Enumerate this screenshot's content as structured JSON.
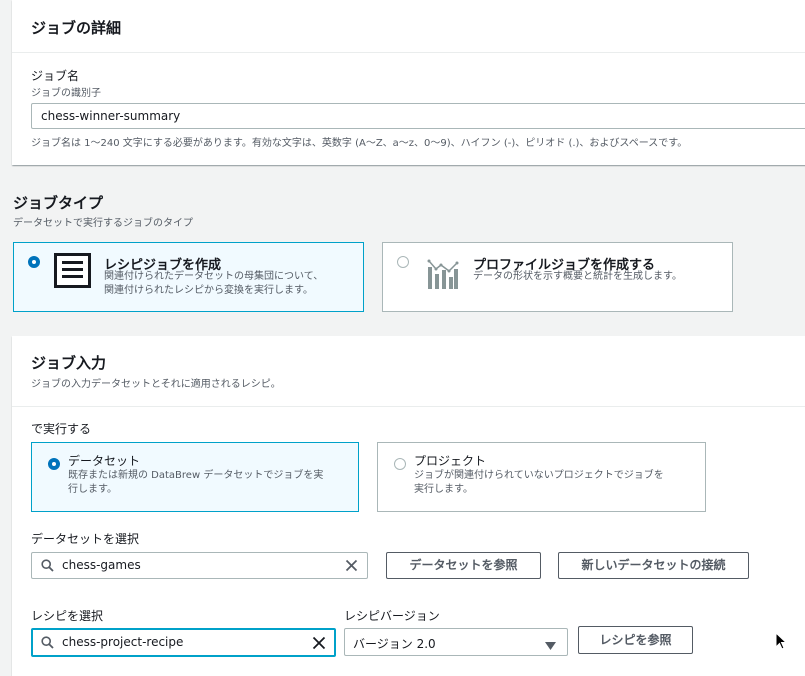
{
  "job_details": {
    "title": "ジョブの詳細",
    "name_label": "ジョブ名",
    "name_desc": "ジョブの識別子",
    "name_value": "chess-winner-summary",
    "name_hint": "ジョブ名は 1〜240 文字にする必要があります。有効な文字は、英数字 (A〜Z、a〜z、0〜9)、ハイフン (-)、ピリオド (.)、およびスペースです。"
  },
  "job_type": {
    "title": "ジョブタイプ",
    "desc": "データセットで実行するジョブのタイプ",
    "options": [
      {
        "title": "レシピジョブを作成",
        "desc_line1": "関連付けられたデータセットの母集団について、",
        "desc_line2": "関連付けられたレシピから変換を実行します。",
        "selected": true,
        "icon": "recipe-icon"
      },
      {
        "title": "プロファイルジョブを作成する",
        "desc_line1": "データの形状を示す概要と統計を生成します。",
        "selected": false,
        "icon": "profile-chart-icon"
      }
    ]
  },
  "job_input": {
    "title": "ジョブ入力",
    "desc": "ジョブの入力データセットとそれに適用されるレシピ。",
    "run_on_label": "で実行する",
    "run_on_options": [
      {
        "title": "データセット",
        "desc_line1": "既存または新規の DataBrew データセットでジョブを実",
        "desc_line2": "行します。",
        "selected": true
      },
      {
        "title": "プロジェクト",
        "desc_line1": "ジョブが関連付けられていないプロジェクトでジョブを",
        "desc_line2": "実行します。",
        "selected": false
      }
    ],
    "dataset_label": "データセットを選択",
    "dataset_value": "chess-games",
    "browse_dataset_button": "データセットを参照",
    "connect_dataset_button": "新しいデータセットの接続",
    "recipe_label": "レシピを選択",
    "recipe_value": "chess-project-recipe",
    "recipe_version_label": "レシピバージョン",
    "recipe_version_value": "バージョン 2.0",
    "browse_recipe_button": "レシピを参照"
  },
  "colors": {
    "accent": "#0073bb",
    "focus": "#00a1c9",
    "selected_bg": "#f1faff"
  }
}
